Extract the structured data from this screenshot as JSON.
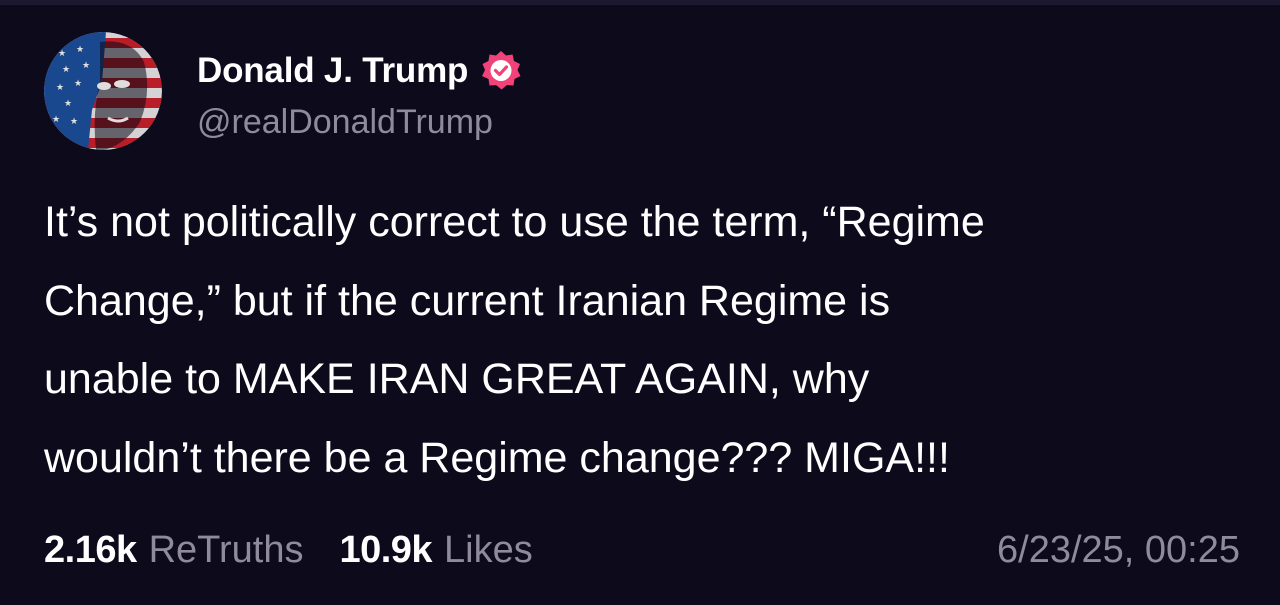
{
  "post": {
    "author": {
      "display_name": "Donald J. Trump",
      "handle": "@realDonaldTrump",
      "verified_icon": "verified-badge-icon",
      "avatar_icon": "avatar-flag-portrait"
    },
    "text_lines": [
      "It’s not politically correct to use the term, “Regime",
      "Change,” but if the current Iranian Regime is",
      "unable to MAKE IRAN GREAT AGAIN, why",
      "wouldn’t there be a Regime change??? MIGA!!!"
    ],
    "stats": {
      "retruths_count": "2.16k",
      "retruths_label": "ReTruths",
      "likes_count": "10.9k",
      "likes_label": "Likes"
    },
    "timestamp": "6/23/25, 00:25"
  },
  "colors": {
    "background": "#0d0a1c",
    "primary_text": "#ffffff",
    "secondary_text": "#8f8a9e",
    "verified_badge": "#f0437a"
  }
}
